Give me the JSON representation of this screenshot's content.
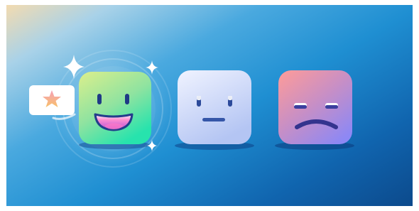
{
  "scene": {
    "faces": [
      {
        "mood": "happy",
        "selected": true
      },
      {
        "mood": "neutral",
        "selected": false
      },
      {
        "mood": "sad",
        "selected": false
      }
    ],
    "bubble_icon": "star-icon",
    "colors": {
      "happy_top": "#d9f08a",
      "happy_bottom": "#2ee6a9",
      "neutral_top": "#eef1ff",
      "neutral_bottom": "#b9c8f5",
      "sad_top": "#ff9a9a",
      "sad_bottom": "#8f86f2",
      "face_features": "#243d8c",
      "star": "#f49ab6"
    }
  }
}
